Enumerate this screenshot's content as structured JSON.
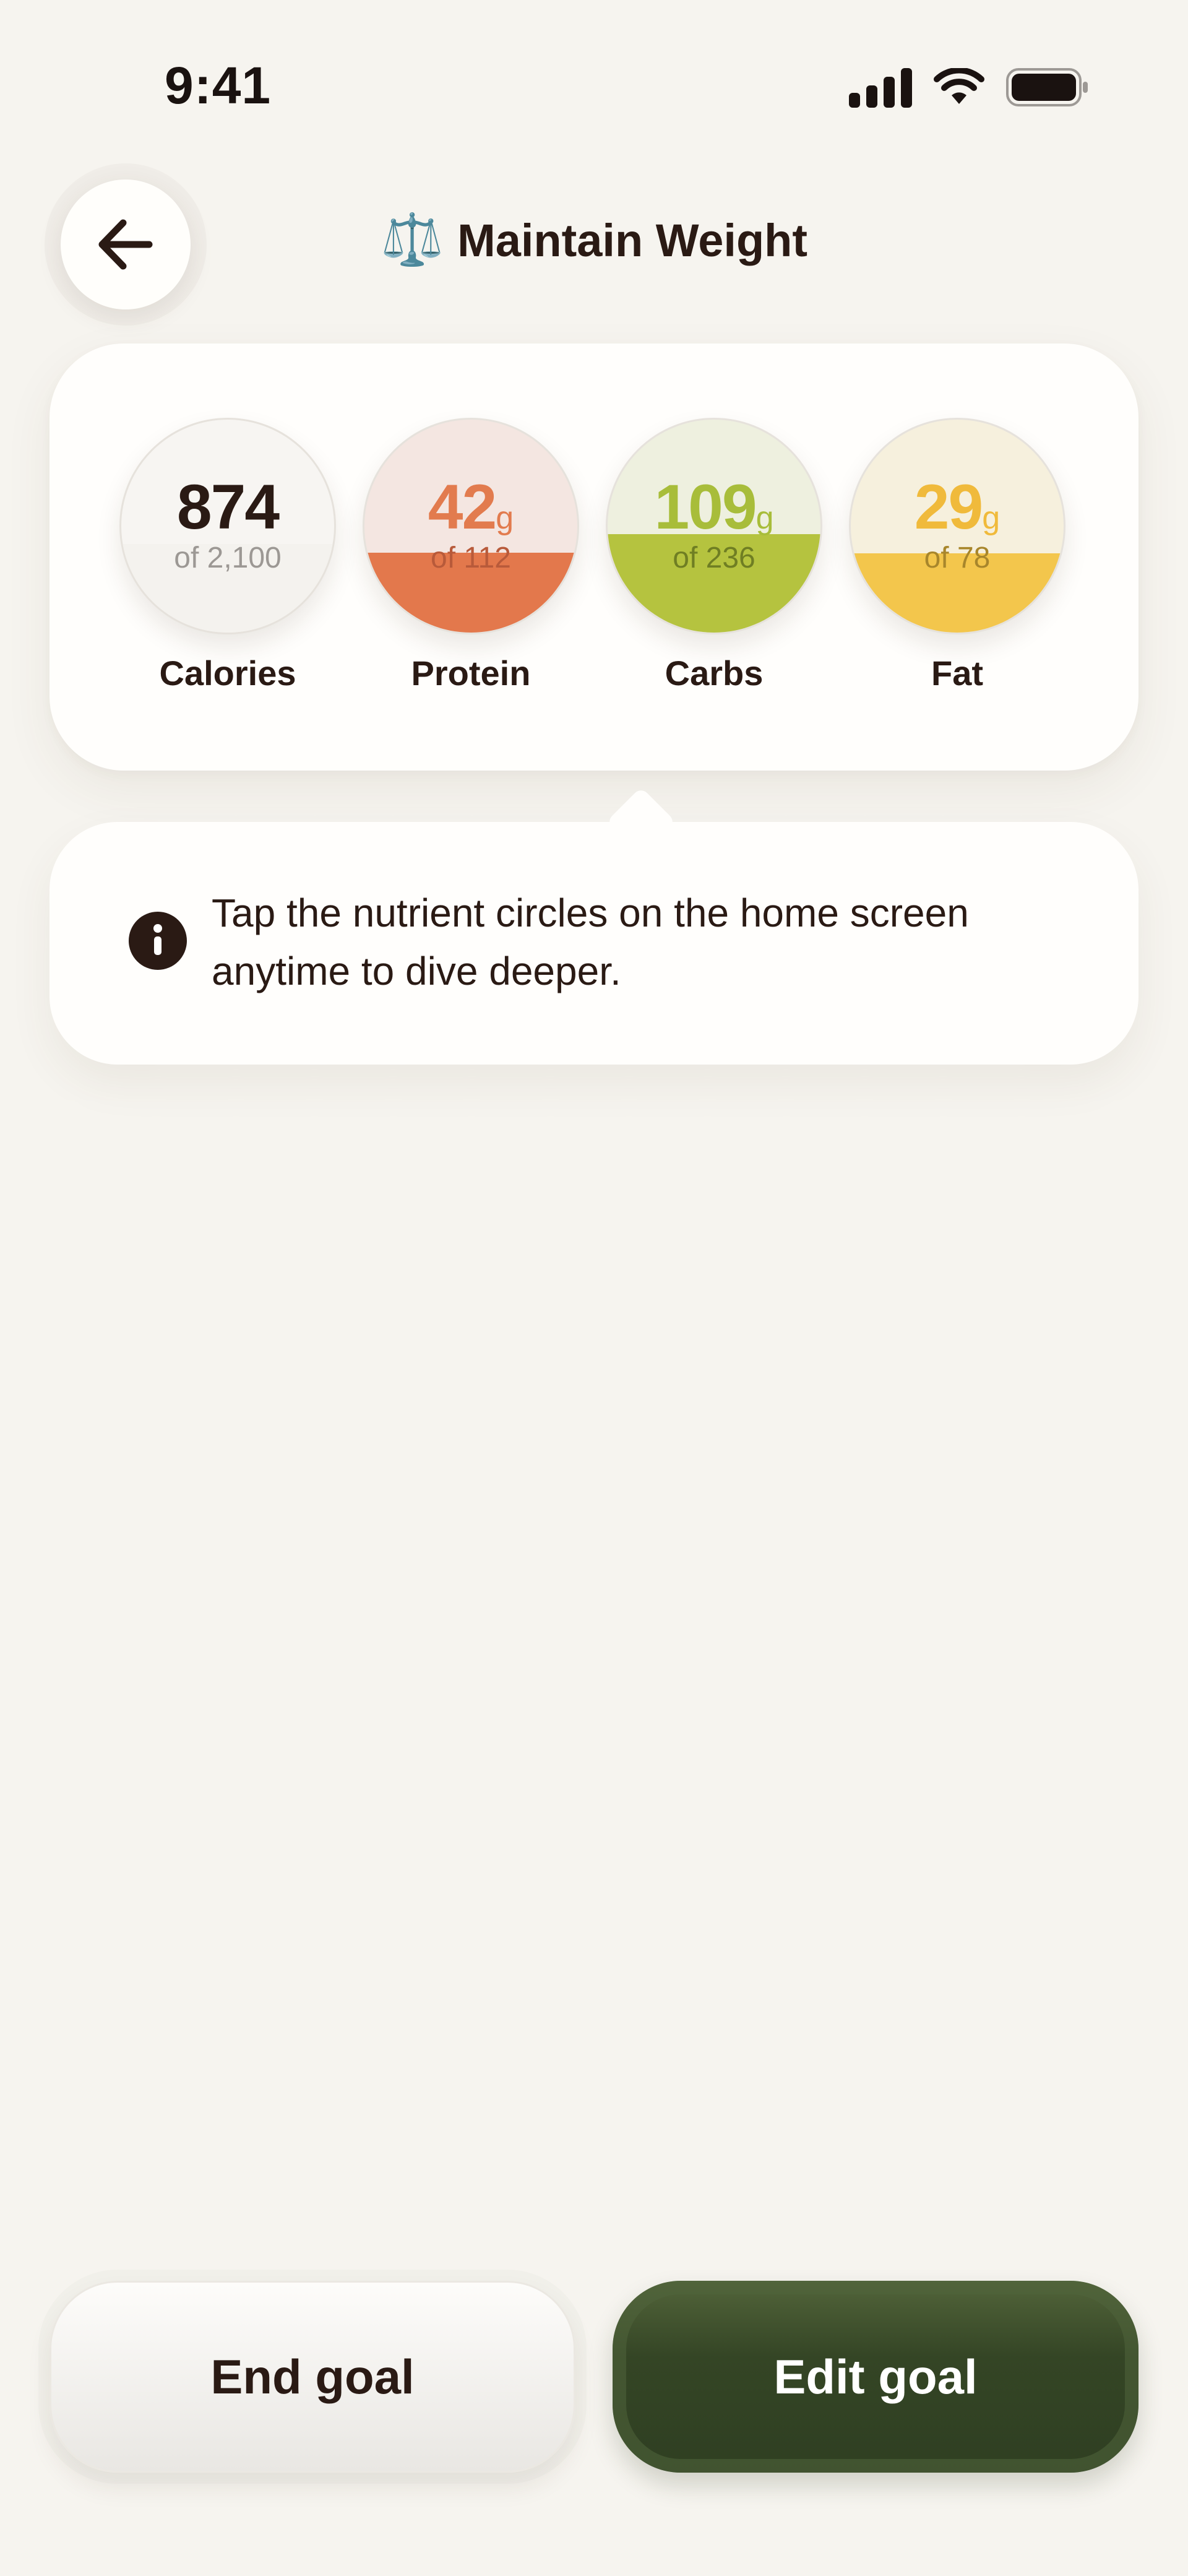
{
  "status_bar": {
    "time": "9:41"
  },
  "header": {
    "back_icon": "arrow-left-icon",
    "emoji": "⚖️",
    "title": "Maintain Weight"
  },
  "macros": [
    {
      "label": "Calories",
      "value": "874",
      "unit": "",
      "target": "of 2,100",
      "fill_fraction": 0.416,
      "value_color": "#2a1a14",
      "target_color": "#9c9894",
      "fill_color": "#f4f2ee",
      "bg_color": "#f7f5f2"
    },
    {
      "label": "Protein",
      "value": "42",
      "unit": "g",
      "target": "of 112",
      "fill_fraction": 0.375,
      "value_color": "#e27b4e",
      "target_color": "#b85a3a",
      "fill_color": "#e3784c",
      "bg_color": "#f4e6e1"
    },
    {
      "label": "Carbs",
      "value": "109",
      "unit": "g",
      "target": "of 236",
      "fill_fraction": 0.462,
      "value_color": "#a8bd3a",
      "target_color": "#6f7e23",
      "fill_color": "#b5c33f",
      "bg_color": "#eef0df"
    },
    {
      "label": "Fat",
      "value": "29",
      "unit": "g",
      "target": "of 78",
      "fill_fraction": 0.372,
      "value_color": "#f0ba3b",
      "target_color": "#a8862b",
      "fill_color": "#f3c64c",
      "bg_color": "#f6f0dd"
    }
  ],
  "tip": {
    "icon": "info-icon",
    "text": "Tap the nutrient circles on the home screen anytime to dive deeper."
  },
  "buttons": {
    "end_label": "End goal",
    "edit_label": "Edit goal"
  }
}
